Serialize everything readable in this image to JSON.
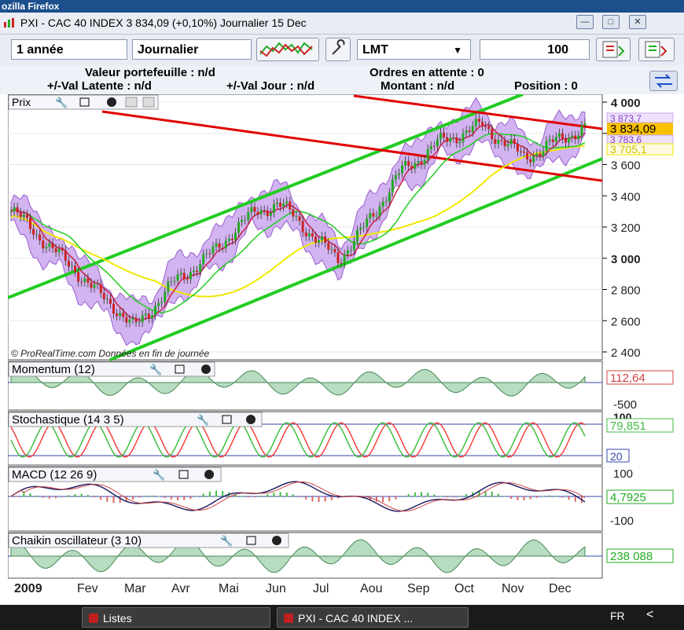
{
  "window": {
    "title": "ozilla Firefox"
  },
  "toolbar": {
    "title": "PXI - CAC 40 INDEX    3 834,09 (+0,10%)    Journalier  15 Dec",
    "min_icon": "minimize-icon",
    "max_icon": "maximize-icon",
    "close_icon": "close-icon"
  },
  "controls": {
    "period": "1 année",
    "frequency": "Journalier",
    "order_type": "LMT",
    "quantity": "100"
  },
  "portfolio": {
    "valeur": "Valeur portefeuille : n/d",
    "ordres": "Ordres en attente : 0",
    "latente": "+/-Val Latente : n/d",
    "jour": "+/-Val Jour : n/d",
    "montant": "Montant : n/d",
    "position": "Position : 0"
  },
  "colors": {
    "channel_green": "#22cc22",
    "resist_red": "#e00000",
    "band_fill": "#c9a8ee",
    "ma_yellow": "#f0e800",
    "ma_green": "#22cc22",
    "price_label_bg": "#f8c000"
  },
  "panels": {
    "price": {
      "title": "Prix",
      "credit": "© ProRealTime.com  Données en fin de journée",
      "current": "3 834,09",
      "labels": [
        "3 873,7",
        "3 783,6",
        "3 705,1"
      ]
    },
    "momentum": {
      "title": "Momentum (12)",
      "value": "112,64"
    },
    "stochastic": {
      "title": "Stochastique (14 3 5)",
      "value": "79,851",
      "level": "20"
    },
    "macd": {
      "title": "MACD (12 26 9)",
      "value": "4,7925"
    },
    "chaikin": {
      "title": "Chaikin oscillateur (3 10)",
      "value": "238 088"
    }
  },
  "chart_data": {
    "type": "line",
    "title": "PXI - CAC 40 INDEX",
    "x_labels": [
      "2009",
      "Fev",
      "Mar",
      "Avr",
      "Mai",
      "Jun",
      "Jul",
      "Aou",
      "Sep",
      "Oct",
      "Nov",
      "Dec"
    ],
    "price_axis": [
      "4 000",
      "3 800",
      "3 600",
      "3 400",
      "3 200",
      "3 000",
      "2 800",
      "2 600",
      "2 400"
    ],
    "ylim": [
      2400,
      4000
    ],
    "momentum_axis": [
      "-500"
    ],
    "stoch_axis": [
      "100",
      "20"
    ],
    "macd_axis": [
      "100",
      "-100"
    ],
    "series": [
      {
        "name": "Prix",
        "values": [
          3300,
          3200,
          3050,
          2950,
          2800,
          2700,
          2550,
          2700,
          2850,
          2950,
          3050,
          3200,
          3300,
          3350,
          3250,
          3100,
          3000,
          3150,
          3350,
          3550,
          3650,
          3750,
          3800,
          3850,
          3750,
          3650,
          3700,
          3780,
          3834
        ]
      }
    ]
  }
}
